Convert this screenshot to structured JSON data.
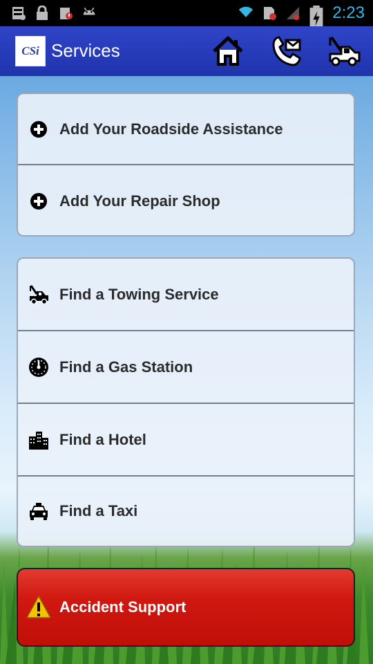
{
  "status_bar": {
    "time": "2:23",
    "left_icons": [
      "sd-card-icon",
      "lock-icon",
      "download-warning-icon",
      "android-icon"
    ],
    "right_icons": [
      "wifi-icon",
      "sim-card-icon",
      "signal-icon",
      "battery-icon"
    ]
  },
  "action_bar": {
    "logo_text": "CSi",
    "title": "Services",
    "buttons": [
      {
        "name": "home-icon"
      },
      {
        "name": "phone-icon"
      },
      {
        "name": "tow-truck-icon"
      }
    ],
    "color": "#2a3fbf"
  },
  "add_group": [
    {
      "label": "Add Your Roadside Assistance",
      "icon": "plus-circle-icon"
    },
    {
      "label": "Add Your Repair Shop",
      "icon": "plus-circle-icon"
    }
  ],
  "find_group": [
    {
      "label": "Find a Towing Service",
      "icon": "tow-truck-icon"
    },
    {
      "label": "Find a Gas Station",
      "icon": "fuel-gauge-icon"
    },
    {
      "label": "Find a Hotel",
      "icon": "hotel-icon"
    },
    {
      "label": "Find a Taxi",
      "icon": "taxi-icon"
    }
  ],
  "accident": {
    "label": "Accident Support",
    "icon": "warning-icon",
    "color": "#cc150e"
  }
}
